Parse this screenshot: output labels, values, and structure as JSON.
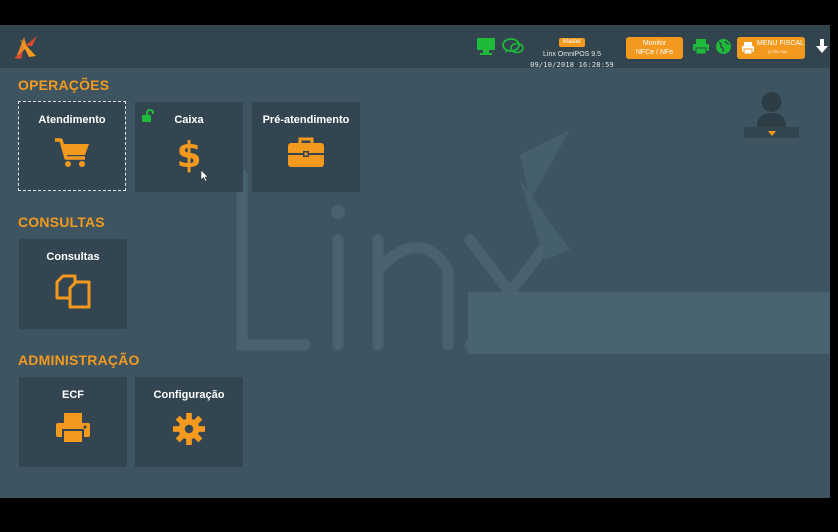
{
  "header": {
    "badge": "Master",
    "app_name": "Linx OmniPOS 9.5",
    "datetime": "09/10/2018 16:28:59",
    "monitor_line1": "Monitor",
    "monitor_line2": "NFCe / NFe",
    "fiscal_label": "MENU FISCAL",
    "fiscal_shortcut": "(CTRL+M)"
  },
  "sections": {
    "operacoes": {
      "title": "OPERAÇÕES",
      "tiles": [
        {
          "label": "Atendimento",
          "icon": "cart-icon"
        },
        {
          "label": "Caixa",
          "icon": "dollar-icon",
          "status_icon": "unlock-icon"
        },
        {
          "label": "Pré-atendimento",
          "icon": "briefcase-icon"
        }
      ]
    },
    "consultas": {
      "title": "CONSULTAS",
      "tiles": [
        {
          "label": "Consultas",
          "icon": "documents-icon"
        }
      ]
    },
    "administracao": {
      "title": "ADMINISTRAÇÃO",
      "tiles": [
        {
          "label": "ECF",
          "icon": "printer-icon"
        },
        {
          "label": "Configuração",
          "icon": "gear-icon"
        }
      ]
    }
  },
  "colors": {
    "accent": "#f39a1e",
    "background": "#3e5561",
    "tile": "#324550",
    "status_green": "#1fba3a"
  }
}
